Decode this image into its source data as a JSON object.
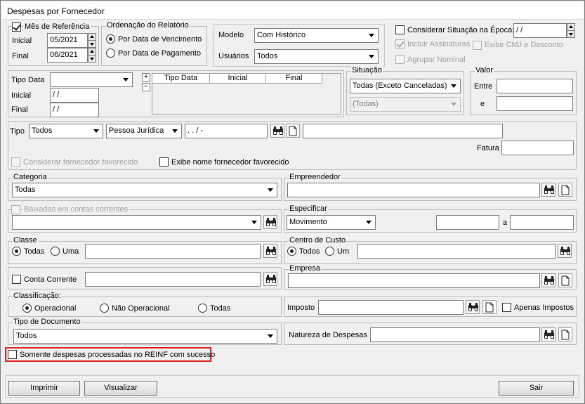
{
  "window": {
    "title": "Despesas por Fornecedor"
  },
  "mes_referencia": {
    "label": "Mês de Referência",
    "checked": true,
    "inicial_label": "Inicial",
    "inicial_value": "05/2021",
    "final_label": "Final",
    "final_value": "06/2021"
  },
  "ordenacao": {
    "title": "Ordenação do Relatório",
    "options": [
      "Por Data de Vencimento",
      "Por Data de Pagamento"
    ],
    "selected": 0
  },
  "modelo": {
    "label": "Modelo",
    "value": "Com Histórico"
  },
  "usuarios": {
    "label": "Usuários",
    "value": "Todos"
  },
  "right_opts": {
    "considerar_situacao": "Considerar Situação na Época:",
    "epoca_value": " / /",
    "incluir_assinaturas": "Incluir Assinaturas",
    "exibir_cmj": "Exibir CMJ e Desconto",
    "agrupar_nominal": "Agrupar Nominal"
  },
  "tipo_data": {
    "label": "Tipo Data",
    "value": "",
    "inicial_label": "Inicial",
    "inicial_value": " / /",
    "final_label": "Final",
    "final_value": " / /",
    "plus": "+",
    "minus": "−",
    "columns": [
      "Tipo Data",
      "Inicial",
      "Final"
    ]
  },
  "situacao": {
    "title": "Situação",
    "value": "Todas (Exceto Canceladas)",
    "value2": "(Todas)"
  },
  "valor": {
    "title": "Valor",
    "entre_label": "Entre",
    "e_label": "e"
  },
  "tipo": {
    "label": "Tipo",
    "tipo_value": "Todos",
    "pessoa_value": "Pessoa Jurídica",
    "doc_value": " .  .  /  -",
    "fatura_label": "Fatura"
  },
  "considerar_favorecido": "Considerar fornecedor favorecido",
  "exibe_nome_favorecido": "Exibe nome fornecedor favorecido",
  "categoria": {
    "title": "Categoria",
    "value": "Todas"
  },
  "empreendedor": {
    "title": "Empreendedor"
  },
  "baixadas": {
    "title": "Baixadas em contas correntes"
  },
  "especificar": {
    "title": "Especificar",
    "value": "Movimento",
    "a_label": "a"
  },
  "classe": {
    "title": "Classe",
    "todas": "Todas",
    "uma": "Uma"
  },
  "centro_custo": {
    "title": "Centro de Custo",
    "todos": "Todos",
    "um": "Um"
  },
  "conta_corrente": {
    "label": "Conta Corrente"
  },
  "empresa": {
    "title": "Empresa"
  },
  "classificacao": {
    "title": "Classificação:",
    "options": [
      "Operacional",
      "Não Operacional",
      "Todas"
    ],
    "selected": 0
  },
  "imposto": {
    "label": "Imposto",
    "apenas": "Apenas Impostos"
  },
  "tipo_documento": {
    "title": "Tipo de Documento",
    "value": "Todos"
  },
  "natureza": {
    "label": "Natureza de Despesas"
  },
  "somente_reinf": "Somente despesas processadas no REINF com sucesso",
  "buttons": {
    "imprimir": "Imprimir",
    "visualizar": "Visualizar",
    "sair": "Sair"
  },
  "colors": {
    "highlight": "#e02020"
  }
}
